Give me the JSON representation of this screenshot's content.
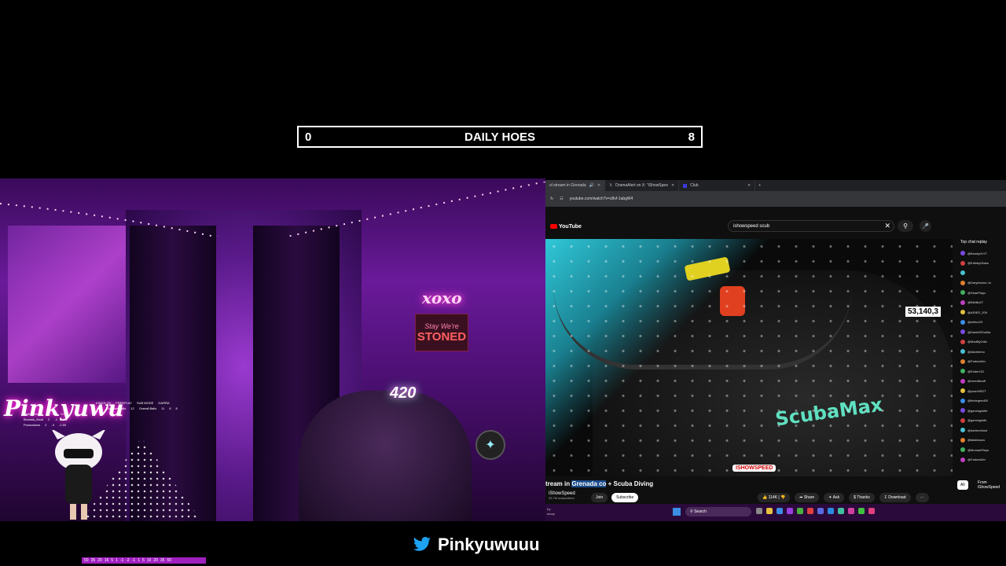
{
  "counter": {
    "left_value": "0",
    "title": "DAILY HOES",
    "right_value": "8"
  },
  "webcam": {
    "logo_text": "Pinkyuwu",
    "neon_xoxo": "xoxo",
    "sign_line1": "Stay We're",
    "sign_line2": "STONED",
    "neon_420": "420",
    "scoreboard": {
      "headers": [
        "KINGS OV",
        "FREEPLAY",
        "SUB MODE",
        "GARRA"
      ],
      "rows": [
        [
          "Sunnies Balls",
          "12",
          "Overall Balls",
          "11",
          "8",
          "8"
        ],
        [
          "NightTime83",
          "7",
          "56",
          "0.00"
        ],
        [
          "Broasta_Arcal",
          "2",
          "-1",
          "-0.2"
        ],
        [
          "Productions",
          "2",
          "-3",
          "-1.50"
        ]
      ]
    },
    "bottom_strip": [
      "50",
      "35",
      "20",
      "16",
      "5",
      "1",
      "-1",
      "-2",
      "-1",
      "1",
      "5",
      "10",
      "20",
      "35",
      "50"
    ]
  },
  "browser": {
    "tabs": [
      {
        "label": "ol stream in Grenada",
        "active": true
      },
      {
        "label": "DramaAlert on X: \"iShowSpee",
        "active": false
      },
      {
        "label": "Club",
        "active": false
      }
    ],
    "url": "youtube.com/watch?v=z8vf-1abgW4",
    "youtube": {
      "logo_text": "YouTube",
      "search_value": "ishowspeed scub",
      "viewer_count": "53,140,3",
      "channel_overlay": "ISHOWSPEED",
      "video_title_pre": "tream in ",
      "video_title_highlight": "Grenada co",
      "video_title_post": " + Scuba Diving",
      "channel_name": "iShowSpeed",
      "subscribers": "33.7M subscribers",
      "join_label": "Join",
      "subscribe_label": "Subscribe",
      "likes": "114K",
      "share_label": "Share",
      "ask_label": "Ask",
      "thanks_label": "Thanks",
      "download_label": "Download",
      "more_label": "···",
      "chat_header": "Top chat replay",
      "chat_users": [
        "@BoodyOrYT",
        "@EdinbyOtaku",
        "",
        "@Daryldonne.Jo",
        "@SiraePlayz",
        "@Bibiiilo27",
        "@ARIES_209",
        "@milton23",
        "@Daniel9Gorilla",
        "@MadByOrtiz",
        "@ldddrerino",
        "@FadorsDer",
        "@Erider101",
        "@xmesiltvaff",
        "@yuanVBGT",
        "@thelegend00",
        "@gamingwitht",
        "@gamingwith",
        "@dartendhust",
        "@talaldoocs",
        "@MomanPleys",
        "@FadorsDer"
      ],
      "chip_all": "All",
      "chip_from": "From iShowSpeed"
    },
    "taskbar": {
      "search_placeholder": "Search",
      "left_date_1": "Iry",
      "left_date_2": "ecury"
    }
  },
  "twitter_handle": "Pinkyuwuuu"
}
